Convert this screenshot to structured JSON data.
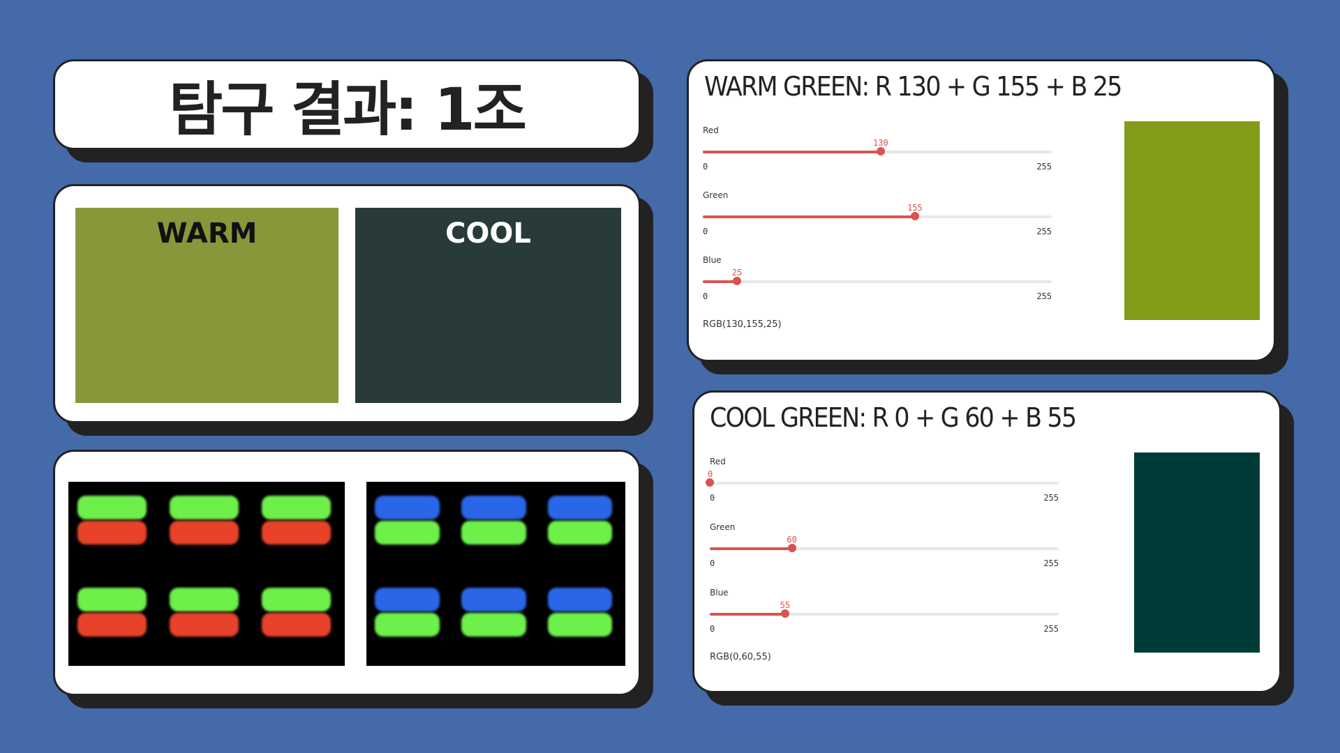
{
  "title": "탐구 결과: 1조",
  "swatches": {
    "warm": {
      "label": "WARM",
      "color": "#87983a",
      "text_color": "#111111"
    },
    "cool": {
      "label": "COOL",
      "color": "#283b39",
      "text_color": "#ffffff"
    }
  },
  "pixel_photos": {
    "left": {
      "subpixels": [
        "green",
        "red"
      ]
    },
    "right": {
      "subpixels": [
        "blue",
        "green"
      ]
    }
  },
  "warm_panel": {
    "heading": "WARM GREEN: R 130 + G 155 + B 25",
    "sliders": [
      {
        "label": "Red",
        "value": 130,
        "min": 0,
        "max": 255
      },
      {
        "label": "Green",
        "value": 155,
        "min": 0,
        "max": 255
      },
      {
        "label": "Blue",
        "value": 25,
        "min": 0,
        "max": 255
      }
    ],
    "rgb_text": "RGB(130,155,25)",
    "preview_color": "#829b19"
  },
  "cool_panel": {
    "heading": "COOL GREEN: R 0 + G 60 + B 55",
    "sliders": [
      {
        "label": "Red",
        "value": 0,
        "min": 0,
        "max": 255
      },
      {
        "label": "Green",
        "value": 60,
        "min": 0,
        "max": 255
      },
      {
        "label": "Blue",
        "value": 55,
        "min": 0,
        "max": 255
      }
    ],
    "rgb_text": "RGB(0,60,55)",
    "preview_color": "#003c37"
  }
}
